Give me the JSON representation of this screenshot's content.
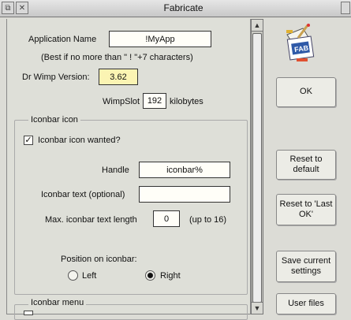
{
  "window": {
    "title": "Fabricate"
  },
  "app": {
    "name_label": "Application Name",
    "name_value": "!MyApp",
    "name_hint": "(Best if no more than \" ! \"+7 characters)",
    "drwimp_label": "Dr Wimp Version:",
    "drwimp_value": "3.62",
    "wimpslot_label": "WimpSlot",
    "wimpslot_value": "192",
    "wimpslot_unit": "kilobytes"
  },
  "iconbar": {
    "group_title": "Iconbar icon",
    "wanted_label": "Iconbar icon wanted?",
    "wanted_checked": "✓",
    "handle_label": "Handle",
    "handle_value": "iconbar%",
    "text_label": "Iconbar text (optional)",
    "text_value": "",
    "maxlen_label": "Max. iconbar text length",
    "maxlen_value": "0",
    "maxlen_hint": "(up to 16)",
    "position_label": "Position on iconbar:",
    "left_label": "Left",
    "right_label": "Right",
    "selected_position": "Right"
  },
  "iconbar_menu": {
    "group_title": "Iconbar menu"
  },
  "buttons": {
    "ok": "OK",
    "reset_default": "Reset to default",
    "reset_last": "Reset to 'Last OK'",
    "save_current": "Save current settings",
    "user_files": "User files"
  },
  "icon": {
    "label": "FAB"
  }
}
